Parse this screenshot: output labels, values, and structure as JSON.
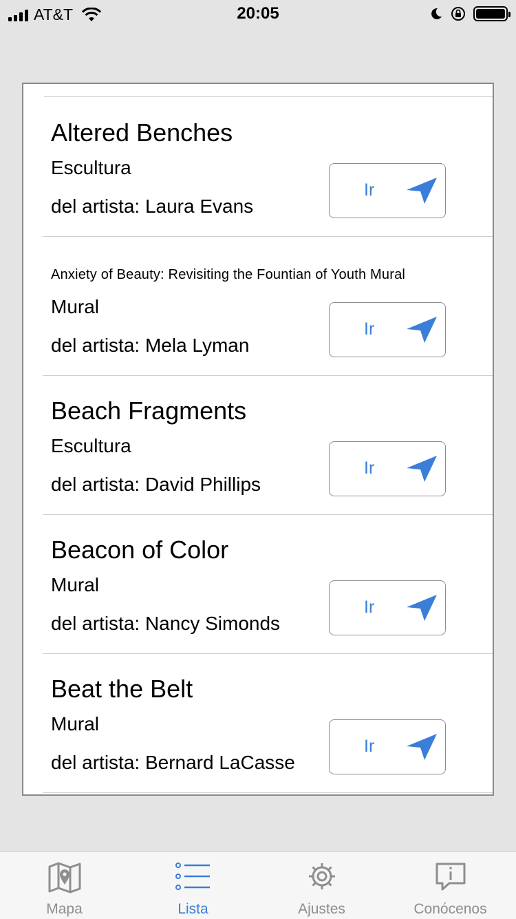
{
  "status_bar": {
    "carrier": "AT&T",
    "time": "20:05"
  },
  "artworks": [
    {
      "title": "Altered Benches",
      "type": "Escultura",
      "artist": "del artista: Laura Evans",
      "button": "Ir"
    },
    {
      "title": "Anxiety of Beauty: Revisiting the Fountian of Youth Mural",
      "type": "Mural",
      "artist": "del artista: Mela Lyman",
      "button": "Ir"
    },
    {
      "title": "Beach Fragments",
      "type": "Escultura",
      "artist": "del artista: David Phillips",
      "button": "Ir"
    },
    {
      "title": "Beacon of Color",
      "type": "Mural",
      "artist": "del artista: Nancy Simonds",
      "button": "Ir"
    },
    {
      "title": "Beat the Belt",
      "type": "Mural",
      "artist": "del artista: Bernard LaCasse",
      "button": "Ir"
    }
  ],
  "tabs": [
    {
      "label": "Mapa",
      "icon": "map-icon",
      "active": false
    },
    {
      "label": "Lista",
      "icon": "list-icon",
      "active": true
    },
    {
      "label": "Ajustes",
      "icon": "gear-icon",
      "active": false
    },
    {
      "label": "Conócenos",
      "icon": "info-bubble-icon",
      "active": false
    }
  ],
  "colors": {
    "accent": "#3a7ed8",
    "inactive_tab": "#8e8e8e",
    "background": "#e4e4e4"
  }
}
